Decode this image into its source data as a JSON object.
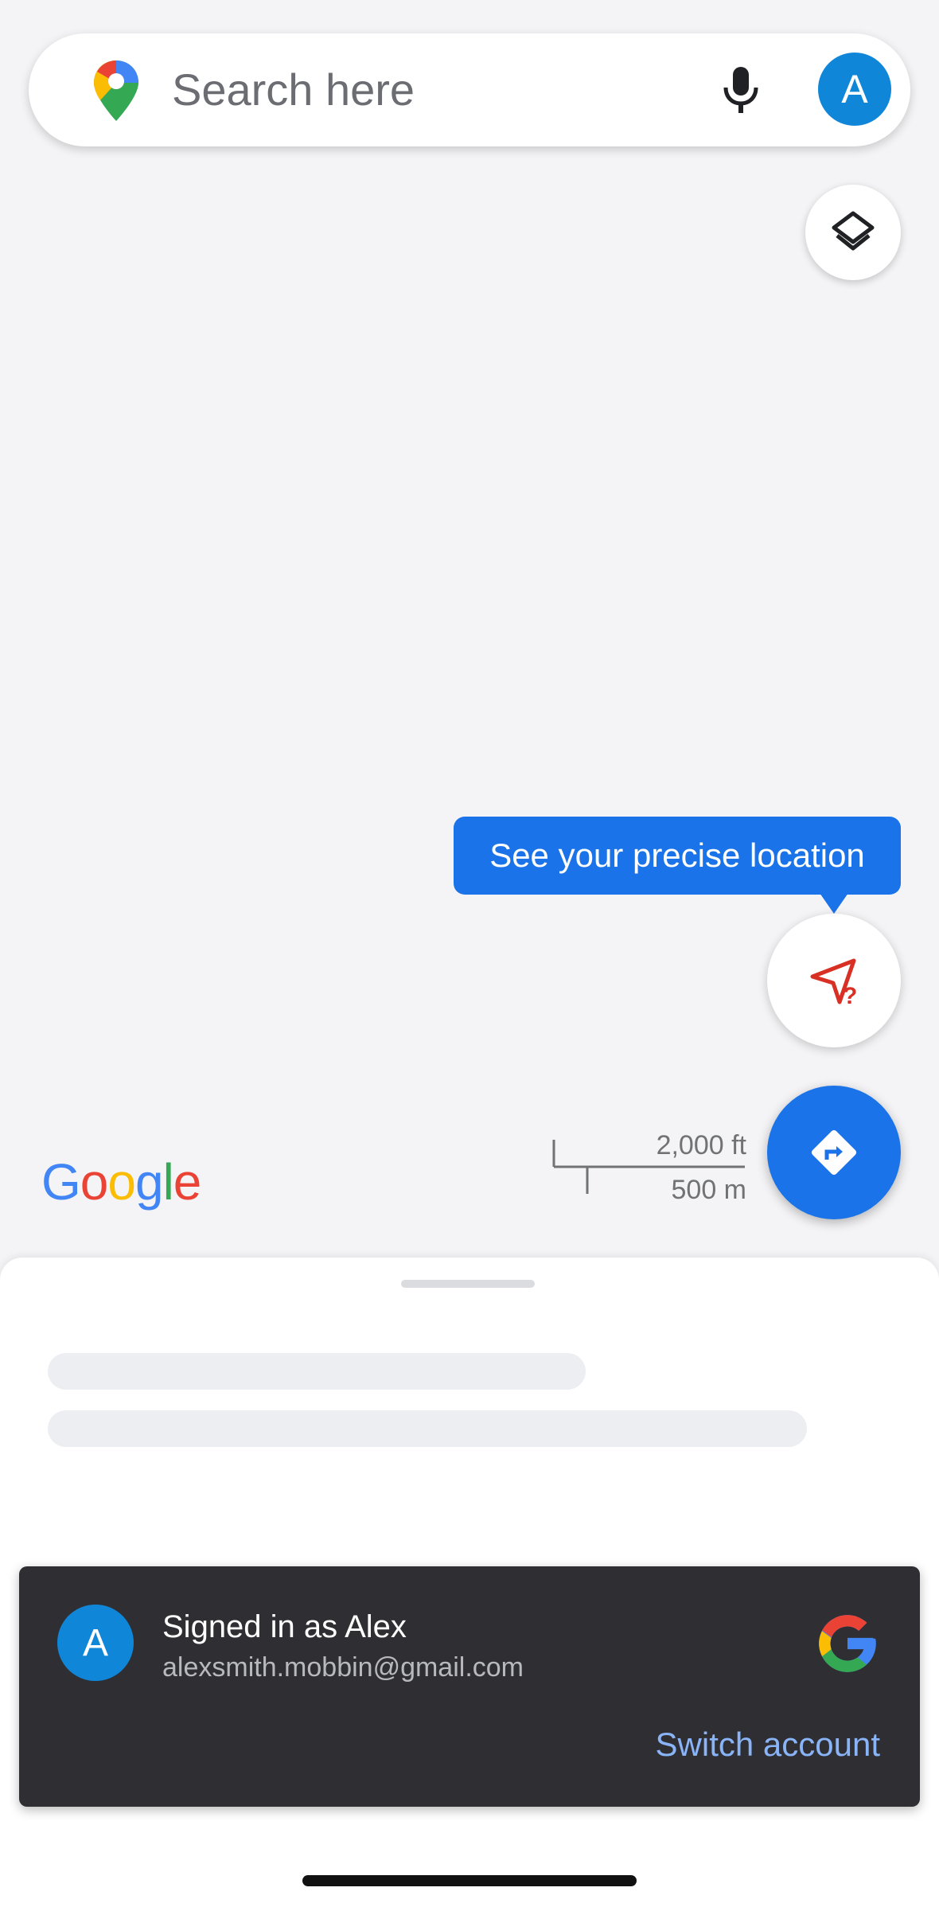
{
  "search": {
    "placeholder": "Search here",
    "avatar_letter": "A"
  },
  "icons": {
    "maps_pin": "maps-pin-icon",
    "mic": "mic-icon",
    "layers": "layers-icon",
    "location": "location-unknown-icon",
    "directions": "directions-icon",
    "google_g": "google-g-icon"
  },
  "tooltip": {
    "text": "See your precise location"
  },
  "map": {
    "logo_letters": [
      "G",
      "o",
      "o",
      "g",
      "l",
      "e"
    ],
    "scale_ft": "2,000 ft",
    "scale_m": "500 m"
  },
  "snackbar": {
    "avatar_letter": "A",
    "title": "Signed in as Alex",
    "email": "alexsmith.mobbin@gmail.com",
    "action": "Switch account"
  },
  "colors": {
    "accent": "#1a73e8",
    "avatar": "#0f86d8",
    "snackbar_bg": "#2f2f33",
    "action_text": "#8ab4f8"
  }
}
